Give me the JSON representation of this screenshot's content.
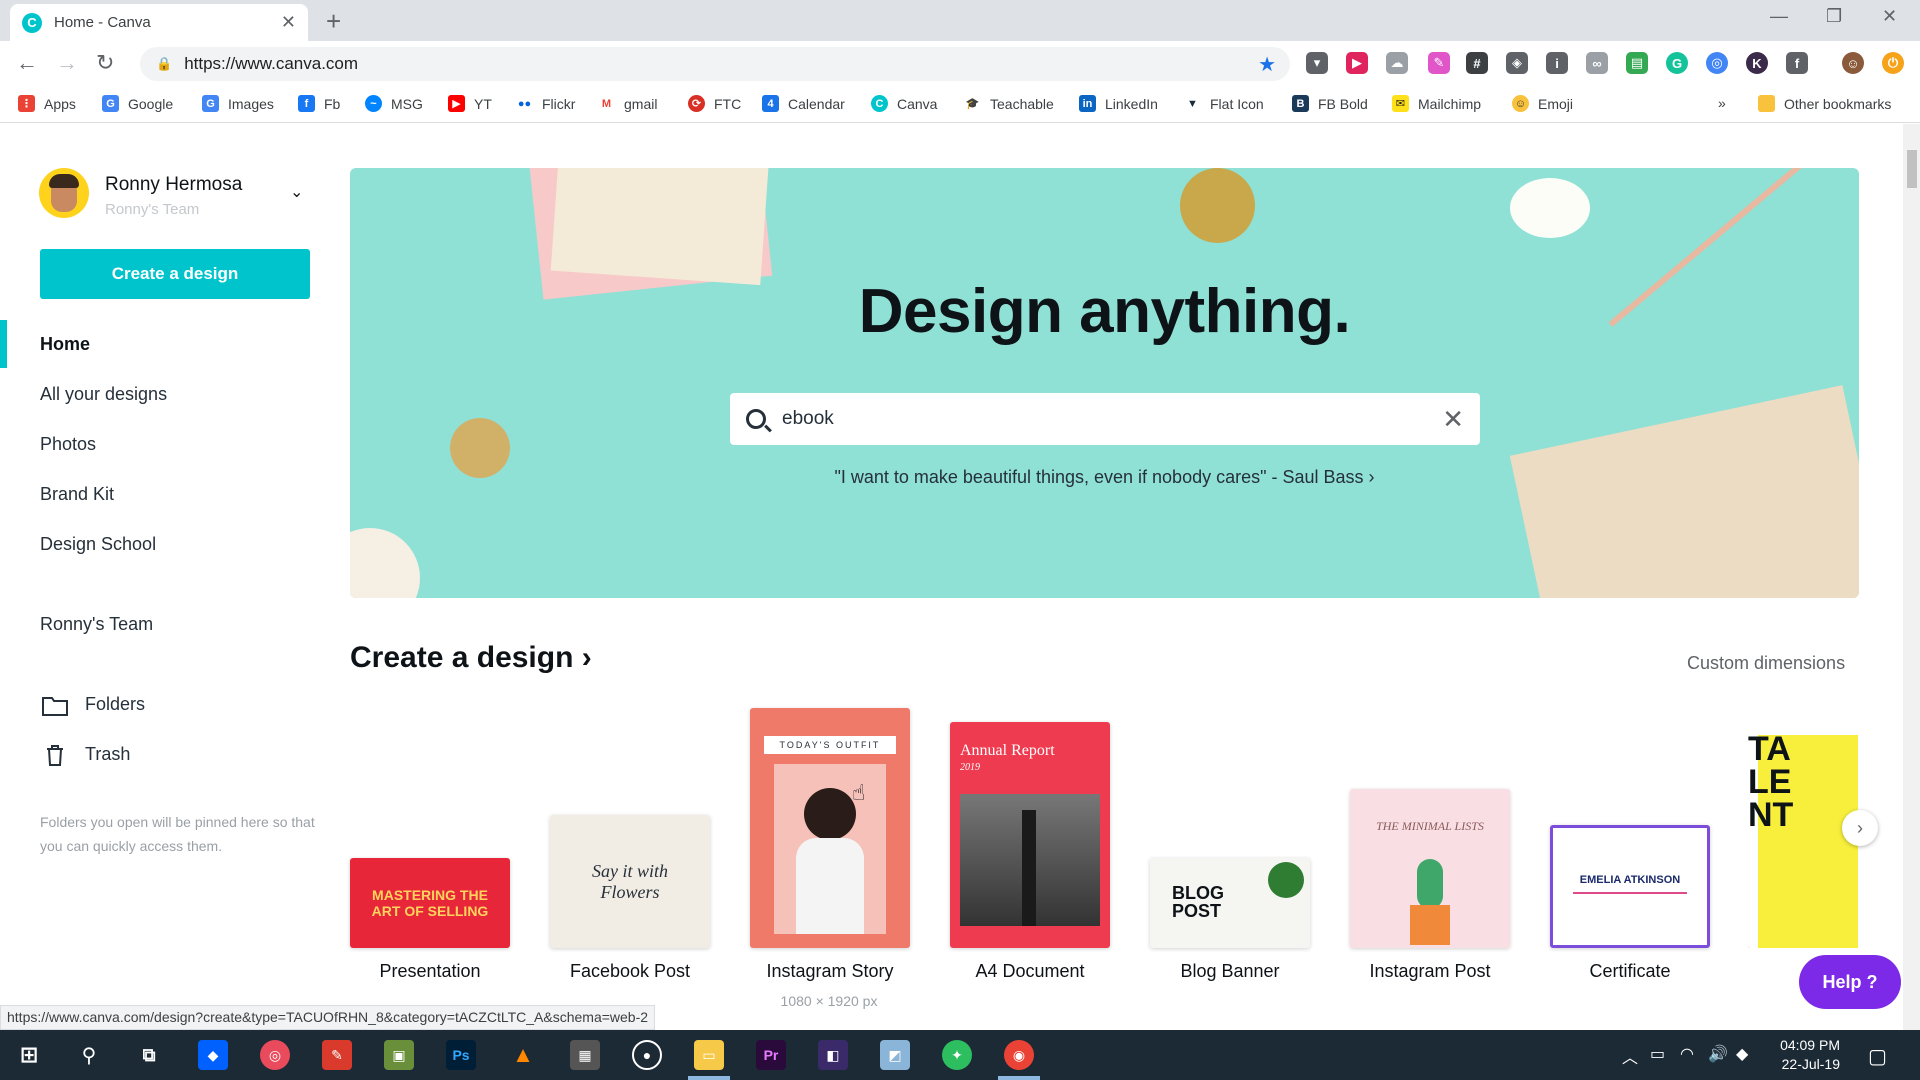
{
  "browser": {
    "tab_title": "Home - Canva",
    "tab_favicon_letter": "C",
    "url": "https://www.canva.com",
    "bookmarks": [
      "Apps",
      "Google",
      "Images",
      "Fb",
      "MSG",
      "YT",
      "Flickr",
      "gmail",
      "FTC",
      "Calendar",
      "Canva",
      "Teachable",
      "LinkedIn",
      "Flat Icon",
      "FB Bold",
      "Mailchimp",
      "Emoji"
    ],
    "more_bookmarks": "»",
    "other_bookmarks": "Other bookmarks"
  },
  "sidebar": {
    "user_name": "Ronny Hermosa",
    "team_name": "Ronny's Team",
    "create_button": "Create a design",
    "nav": [
      "Home",
      "All your designs",
      "Photos",
      "Brand Kit",
      "Design School"
    ],
    "team_link": "Ronny's Team",
    "folders": "Folders",
    "trash": "Trash",
    "pinned_note": "Folders you open will be pinned here so that you can quickly access them."
  },
  "hero": {
    "title": "Design anything.",
    "search_value": "ebook",
    "quote": "\"I want to make beautiful things, even if nobody cares\" - Saul Bass ›"
  },
  "create_section": {
    "title": "Create a design ›",
    "custom_dimensions": "Custom dimensions",
    "cards": [
      {
        "label": "Presentation",
        "thumb_text": "MASTERING THE ART OF SELLING"
      },
      {
        "label": "Facebook Post",
        "thumb_text": "Say it with Flowers"
      },
      {
        "label": "Instagram Story",
        "thumb_text": "TODAY'S OUTFIT"
      },
      {
        "label": "A4 Document",
        "thumb_text": "Annual Report",
        "thumb_sub": "2019"
      },
      {
        "label": "Blog Banner",
        "thumb_text": "BLOG POST"
      },
      {
        "label": "Instagram Post",
        "thumb_text": "THE MINIMAL LISTS"
      },
      {
        "label": "Certificate",
        "thumb_text": "EMELIA ATKINSON"
      },
      {
        "label": "",
        "thumb_text": "TA LE NT"
      }
    ],
    "hover_dims": "1080 × 1920 px"
  },
  "help_button": "Help ?",
  "status_url": "https://www.canva.com/design?create&type=TACUOfRHN_8&category=tACZCtLTC_A&schema=web-2",
  "taskbar": {
    "time": "04:09 PM",
    "date": "22-Jul-19"
  },
  "colors": {
    "accent": "#00c4cc",
    "hero_bg": "#8fe0d5",
    "help": "#7d2ae8"
  }
}
